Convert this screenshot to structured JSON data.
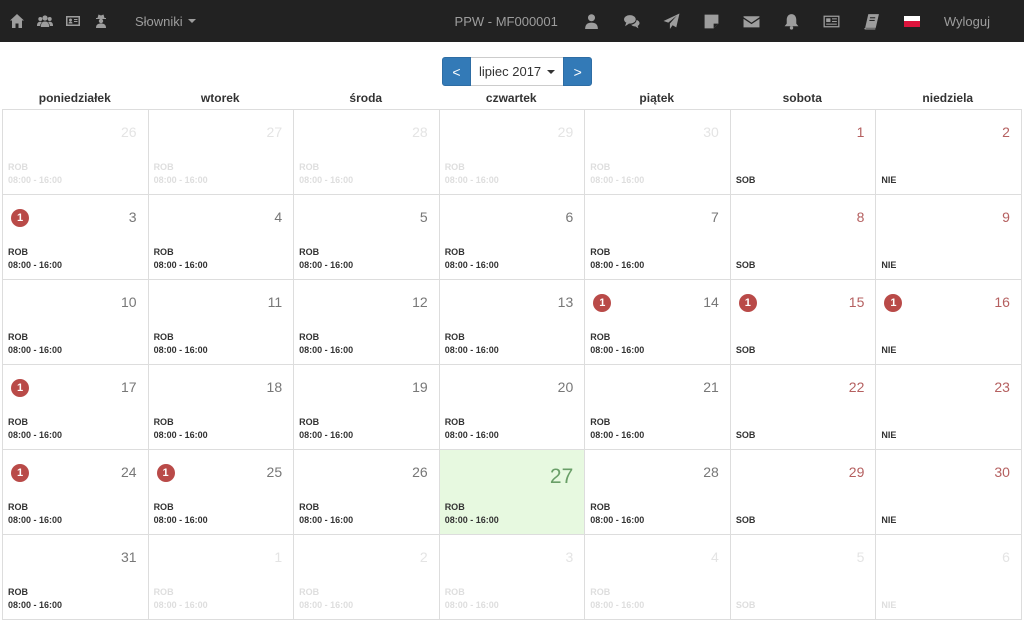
{
  "navbar": {
    "left_icons": [
      "home-icon",
      "users-icon",
      "id-card-icon",
      "user-secret-icon"
    ],
    "dictionary_label": "Słowniki",
    "user_id": "PPW - MF000001",
    "right_icons": [
      "user-icon",
      "comments-icon",
      "send-icon",
      "sticky-note-icon",
      "envelope-icon",
      "bell-icon",
      "newspaper-icon",
      "book-icon"
    ],
    "logout_label": "Wyloguj"
  },
  "switcher": {
    "prev_label": "<",
    "month_label": "lipiec 2017",
    "next_label": ">"
  },
  "weekdays": [
    "poniedziałek",
    "wtorek",
    "środa",
    "czwartek",
    "piątek",
    "sobota",
    "niedziela"
  ],
  "colors": {
    "navbar_bg": "#222222",
    "primary": "#337ab7",
    "badge": "#b94a48",
    "today_bg": "#e7f9e0",
    "weekend_number": "#b56060"
  },
  "days": [
    {
      "num": "26",
      "type": "ROB",
      "hours": "08:00 - 16:00",
      "badge": "",
      "other": true,
      "weekend": false,
      "today": false
    },
    {
      "num": "27",
      "type": "ROB",
      "hours": "08:00 - 16:00",
      "badge": "",
      "other": true,
      "weekend": false,
      "today": false
    },
    {
      "num": "28",
      "type": "ROB",
      "hours": "08:00 - 16:00",
      "badge": "",
      "other": true,
      "weekend": false,
      "today": false
    },
    {
      "num": "29",
      "type": "ROB",
      "hours": "08:00 - 16:00",
      "badge": "",
      "other": true,
      "weekend": false,
      "today": false
    },
    {
      "num": "30",
      "type": "ROB",
      "hours": "08:00 - 16:00",
      "badge": "",
      "other": true,
      "weekend": false,
      "today": false
    },
    {
      "num": "1",
      "type": "SOB",
      "hours": "",
      "badge": "",
      "other": false,
      "weekend": true,
      "today": false
    },
    {
      "num": "2",
      "type": "NIE",
      "hours": "",
      "badge": "",
      "other": false,
      "weekend": true,
      "today": false
    },
    {
      "num": "3",
      "type": "ROB",
      "hours": "08:00 - 16:00",
      "badge": "1",
      "other": false,
      "weekend": false,
      "today": false
    },
    {
      "num": "4",
      "type": "ROB",
      "hours": "08:00 - 16:00",
      "badge": "",
      "other": false,
      "weekend": false,
      "today": false
    },
    {
      "num": "5",
      "type": "ROB",
      "hours": "08:00 - 16:00",
      "badge": "",
      "other": false,
      "weekend": false,
      "today": false
    },
    {
      "num": "6",
      "type": "ROB",
      "hours": "08:00 - 16:00",
      "badge": "",
      "other": false,
      "weekend": false,
      "today": false
    },
    {
      "num": "7",
      "type": "ROB",
      "hours": "08:00 - 16:00",
      "badge": "",
      "other": false,
      "weekend": false,
      "today": false
    },
    {
      "num": "8",
      "type": "SOB",
      "hours": "",
      "badge": "",
      "other": false,
      "weekend": true,
      "today": false
    },
    {
      "num": "9",
      "type": "NIE",
      "hours": "",
      "badge": "",
      "other": false,
      "weekend": true,
      "today": false
    },
    {
      "num": "10",
      "type": "ROB",
      "hours": "08:00 - 16:00",
      "badge": "",
      "other": false,
      "weekend": false,
      "today": false
    },
    {
      "num": "11",
      "type": "ROB",
      "hours": "08:00 - 16:00",
      "badge": "",
      "other": false,
      "weekend": false,
      "today": false
    },
    {
      "num": "12",
      "type": "ROB",
      "hours": "08:00 - 16:00",
      "badge": "",
      "other": false,
      "weekend": false,
      "today": false
    },
    {
      "num": "13",
      "type": "ROB",
      "hours": "08:00 - 16:00",
      "badge": "",
      "other": false,
      "weekend": false,
      "today": false
    },
    {
      "num": "14",
      "type": "ROB",
      "hours": "08:00 - 16:00",
      "badge": "1",
      "other": false,
      "weekend": false,
      "today": false
    },
    {
      "num": "15",
      "type": "SOB",
      "hours": "",
      "badge": "1",
      "other": false,
      "weekend": true,
      "today": false
    },
    {
      "num": "16",
      "type": "NIE",
      "hours": "",
      "badge": "1",
      "other": false,
      "weekend": true,
      "today": false
    },
    {
      "num": "17",
      "type": "ROB",
      "hours": "08:00 - 16:00",
      "badge": "1",
      "other": false,
      "weekend": false,
      "today": false
    },
    {
      "num": "18",
      "type": "ROB",
      "hours": "08:00 - 16:00",
      "badge": "",
      "other": false,
      "weekend": false,
      "today": false
    },
    {
      "num": "19",
      "type": "ROB",
      "hours": "08:00 - 16:00",
      "badge": "",
      "other": false,
      "weekend": false,
      "today": false
    },
    {
      "num": "20",
      "type": "ROB",
      "hours": "08:00 - 16:00",
      "badge": "",
      "other": false,
      "weekend": false,
      "today": false
    },
    {
      "num": "21",
      "type": "ROB",
      "hours": "08:00 - 16:00",
      "badge": "",
      "other": false,
      "weekend": false,
      "today": false
    },
    {
      "num": "22",
      "type": "SOB",
      "hours": "",
      "badge": "",
      "other": false,
      "weekend": true,
      "today": false
    },
    {
      "num": "23",
      "type": "NIE",
      "hours": "",
      "badge": "",
      "other": false,
      "weekend": true,
      "today": false
    },
    {
      "num": "24",
      "type": "ROB",
      "hours": "08:00 - 16:00",
      "badge": "1",
      "other": false,
      "weekend": false,
      "today": false
    },
    {
      "num": "25",
      "type": "ROB",
      "hours": "08:00 - 16:00",
      "badge": "1",
      "other": false,
      "weekend": false,
      "today": false
    },
    {
      "num": "26",
      "type": "ROB",
      "hours": "08:00 - 16:00",
      "badge": "",
      "other": false,
      "weekend": false,
      "today": false
    },
    {
      "num": "27",
      "type": "ROB",
      "hours": "08:00 - 16:00",
      "badge": "",
      "other": false,
      "weekend": false,
      "today": true
    },
    {
      "num": "28",
      "type": "ROB",
      "hours": "08:00 - 16:00",
      "badge": "",
      "other": false,
      "weekend": false,
      "today": false
    },
    {
      "num": "29",
      "type": "SOB",
      "hours": "",
      "badge": "",
      "other": false,
      "weekend": true,
      "today": false
    },
    {
      "num": "30",
      "type": "NIE",
      "hours": "",
      "badge": "",
      "other": false,
      "weekend": true,
      "today": false
    },
    {
      "num": "31",
      "type": "ROB",
      "hours": "08:00 - 16:00",
      "badge": "",
      "other": false,
      "weekend": false,
      "today": false
    },
    {
      "num": "1",
      "type": "ROB",
      "hours": "08:00 - 16:00",
      "badge": "",
      "other": true,
      "weekend": false,
      "today": false
    },
    {
      "num": "2",
      "type": "ROB",
      "hours": "08:00 - 16:00",
      "badge": "",
      "other": true,
      "weekend": false,
      "today": false
    },
    {
      "num": "3",
      "type": "ROB",
      "hours": "08:00 - 16:00",
      "badge": "",
      "other": true,
      "weekend": false,
      "today": false
    },
    {
      "num": "4",
      "type": "ROB",
      "hours": "08:00 - 16:00",
      "badge": "",
      "other": true,
      "weekend": false,
      "today": false
    },
    {
      "num": "5",
      "type": "SOB",
      "hours": "",
      "badge": "",
      "other": true,
      "weekend": true,
      "today": false
    },
    {
      "num": "6",
      "type": "NIE",
      "hours": "",
      "badge": "",
      "other": true,
      "weekend": true,
      "today": false
    }
  ]
}
